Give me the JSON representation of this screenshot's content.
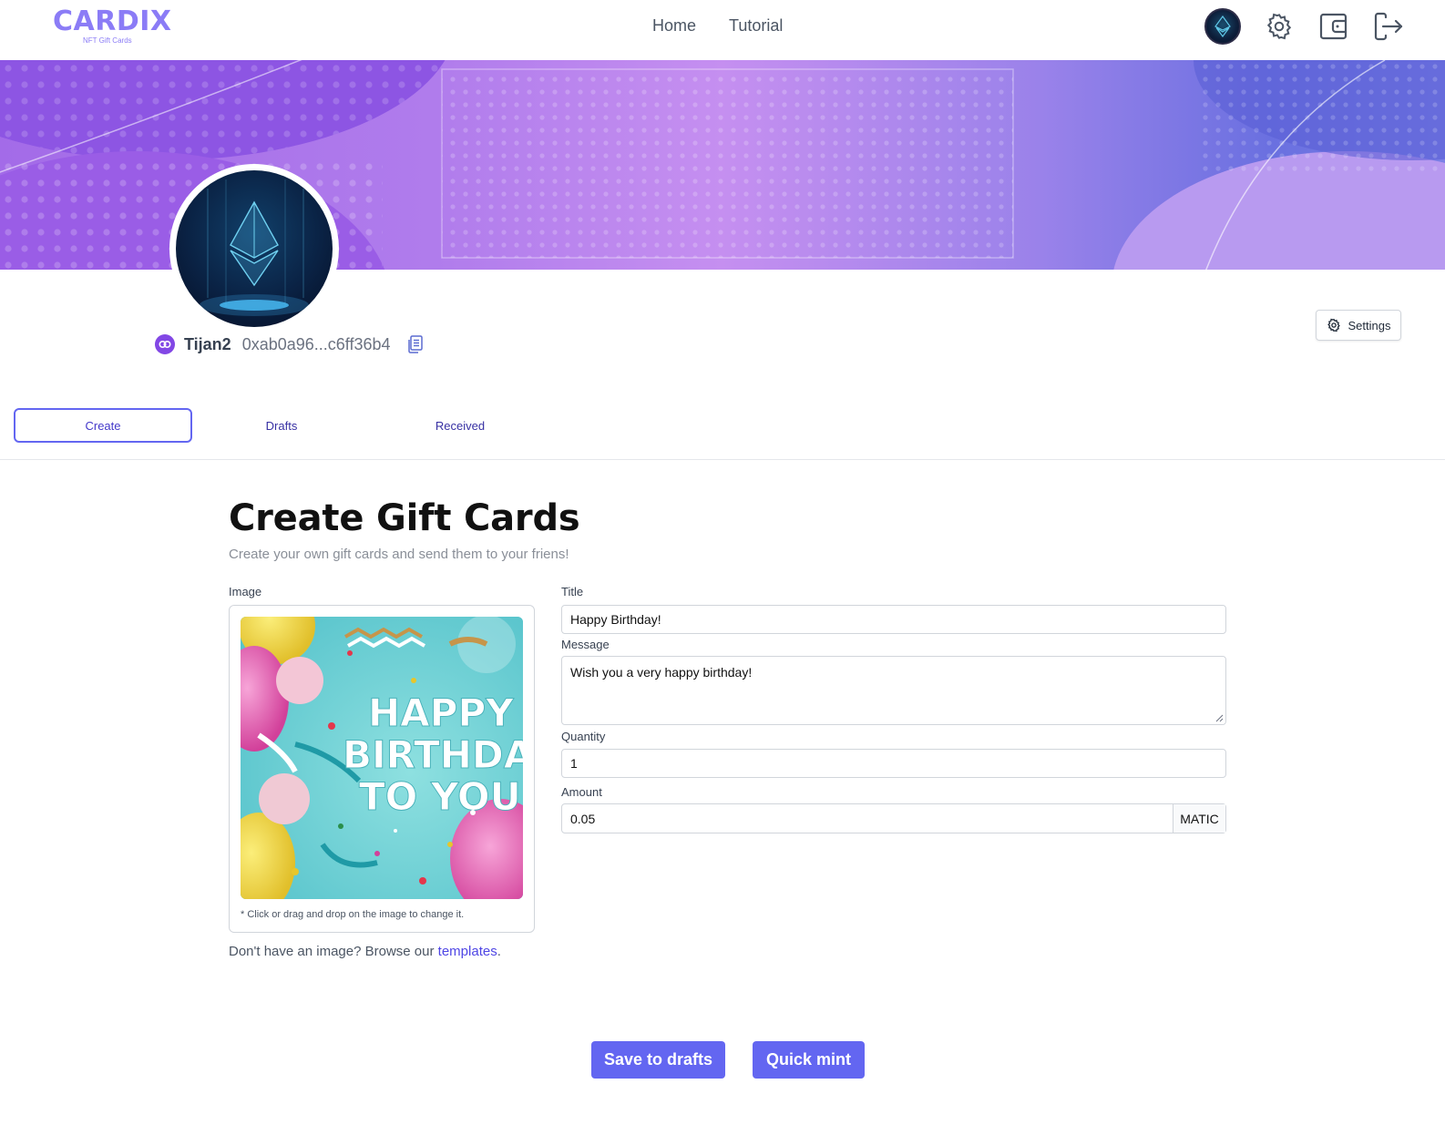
{
  "nav": {
    "logo": "CARDIX",
    "logo_sub": "NFT Gift Cards",
    "links": [
      "Home",
      "Tutorial"
    ],
    "icons": [
      "avatar",
      "gear-icon",
      "wallet-icon",
      "logout-icon"
    ]
  },
  "profile": {
    "username": "Tijan2",
    "address": "0xab0a96...c6ff36b4",
    "settings_label": "Settings"
  },
  "tabs": [
    "Create",
    "Drafts",
    "Received"
  ],
  "page": {
    "title": "Create Gift Cards",
    "subtitle": "Create your own gift cards and send them to your friens!"
  },
  "image_section": {
    "label": "Image",
    "image_text": [
      "HAPPY",
      "BIRTHDAY",
      "TO YOU!"
    ],
    "hint": "* Click or drag and drop on the image to change it.",
    "browse_prefix": "Don't have an image? Browse our ",
    "browse_link": "templates",
    "browse_suffix": "."
  },
  "form": {
    "title_label": "Title",
    "title_value": "Happy Birthday!",
    "message_label": "Message",
    "message_value": "Wish you a very happy birthday!",
    "quantity_label": "Quantity",
    "quantity_value": "1",
    "amount_label": "Amount",
    "amount_value": "0.05",
    "amount_unit": "MATIC"
  },
  "actions": {
    "save_label": "Save to drafts",
    "mint_label": "Quick mint"
  },
  "colors": {
    "accent": "#6366f1",
    "link": "#4f46e5",
    "logo": "#8b7cf6",
    "polygon": "#8247e5"
  }
}
